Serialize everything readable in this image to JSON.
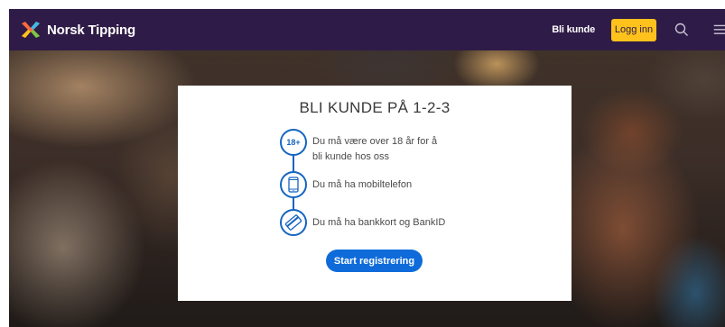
{
  "header": {
    "brand": "Norsk Tipping",
    "bli_kunde": "Bli kunde",
    "login_label": "Logg inn",
    "colors": {
      "bar": "#2f1b47",
      "login": "#ffc21c"
    }
  },
  "card": {
    "title": "BLI KUNDE PÅ 1-2-3",
    "steps": [
      {
        "icon": "age-18-badge-icon",
        "badge": "18+",
        "text": "Du må være over 18 år for å bli kunde hos oss"
      },
      {
        "icon": "mobile-phone-icon",
        "text": "Du må ha mobiltelefon"
      },
      {
        "icon": "bank-card-icon",
        "text": "Du må ha bankkort og BankID"
      }
    ],
    "cta_label": "Start registrering",
    "accent": "#1565c0"
  }
}
